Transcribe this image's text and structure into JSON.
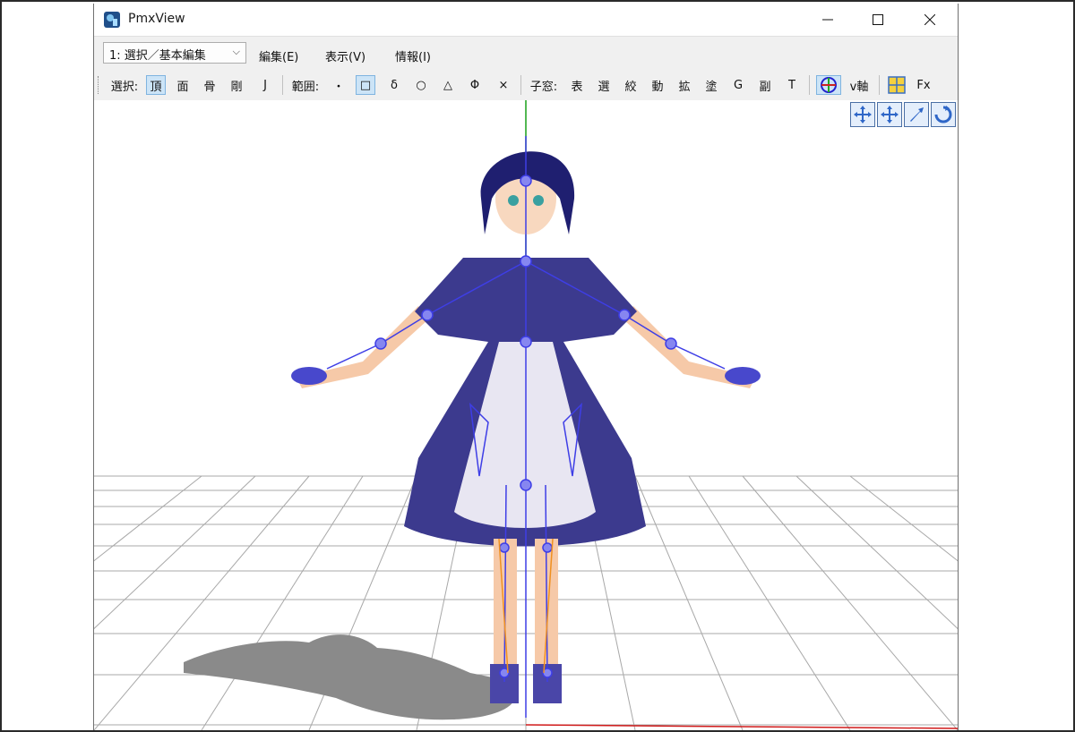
{
  "window": {
    "title": "PmxView"
  },
  "icons": {
    "app": "pmxview-app-icon",
    "minimize": "minimize-icon",
    "maximize": "maximize-icon",
    "close": "close-icon"
  },
  "menubar": {
    "mode_selector": "1: 選択／基本編集",
    "items": [
      "編集(E)",
      "表示(V)",
      "情報(I)"
    ]
  },
  "toolbar": {
    "select_label": "選択:",
    "select_items": [
      "頂",
      "面",
      "骨",
      "剛",
      "J"
    ],
    "range_label": "範囲:",
    "range_items": [
      "・",
      "□",
      "δ",
      "○",
      "△",
      "Φ",
      "×"
    ],
    "subwin_label": "子窓:",
    "subwin_items": [
      "表",
      "選",
      "絞",
      "動",
      "拡",
      "塗",
      "G",
      "副",
      "T"
    ],
    "vaxis_label": "v軸",
    "fx_label": "Fx"
  },
  "viewport_tools": [
    "move-xy-icon",
    "move-xz-icon",
    "move-z-icon",
    "rotate-icon"
  ],
  "colors": {
    "bone": "#3e3ee6",
    "grid": "#a8a8a8",
    "titlebar": "#ffffff",
    "toolbar": "#f0f0f0"
  }
}
